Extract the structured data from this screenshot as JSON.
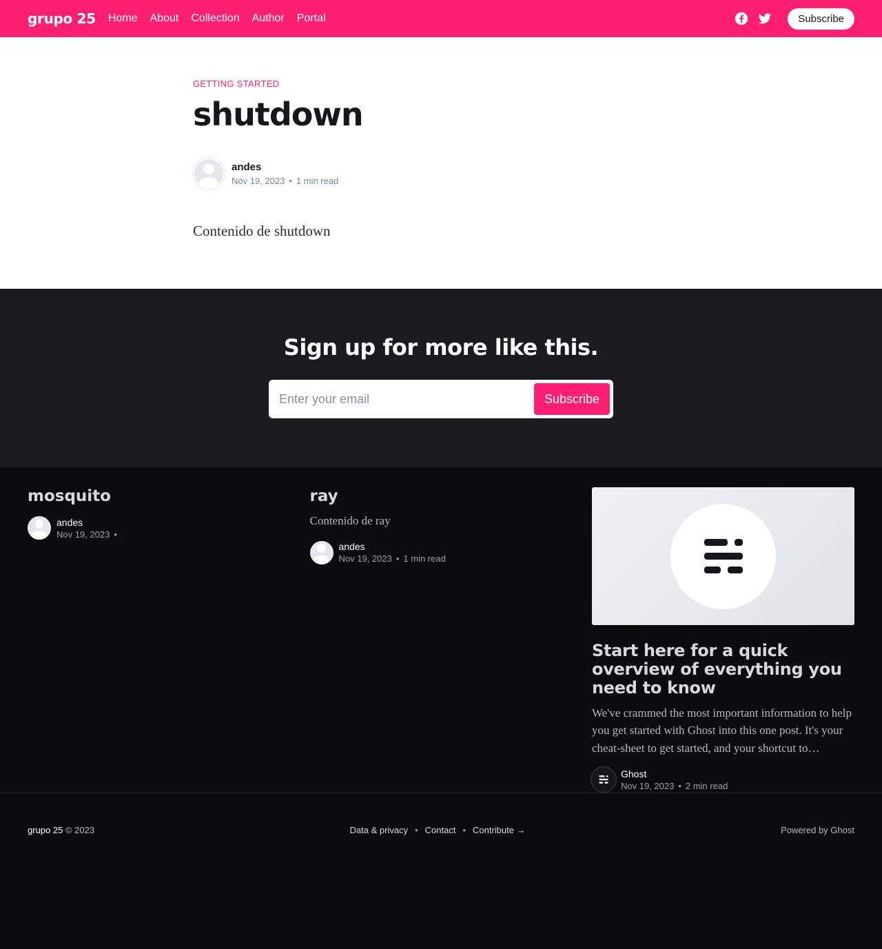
{
  "header": {
    "brand": "grupo 25",
    "nav": [
      "Home",
      "About",
      "Collection",
      "Author",
      "Portal"
    ],
    "social_icons": [
      "facebook-icon",
      "twitter-icon"
    ],
    "subscribe_label": "Subscribe",
    "accent_color": "#ff1f72"
  },
  "article": {
    "tag": "Getting Started",
    "title": "shutdown",
    "author": "andes",
    "date": "Nov 19, 2023",
    "read_time": "1 min read",
    "content": "Contenido de shutdown"
  },
  "cta": {
    "title": "Sign up for more like this.",
    "email_placeholder": "Enter your email",
    "button_label": "Subscribe"
  },
  "related": [
    {
      "title": "mosquito",
      "author": "andes",
      "date": "Nov 19, 2023"
    },
    {
      "title": "ray",
      "excerpt": "Contenido de ray",
      "author": "andes",
      "date": "Nov 19, 2023",
      "read_time": "1 min read"
    },
    {
      "title": "Start here for a quick overview of everything you need to know",
      "excerpt": "We've crammed the most important information to help you get started with Ghost into this one post. It's your cheat-sheet to get started, and your shortcut to…",
      "author": "Ghost",
      "date": "Nov 19, 2023",
      "read_time": "2 min read"
    }
  ],
  "footer": {
    "site_name": "grupo 25",
    "copyright": "© 2023",
    "links": [
      "Data & privacy",
      "Contact",
      "Contribute →"
    ],
    "powered_by": "Powered by Ghost"
  }
}
